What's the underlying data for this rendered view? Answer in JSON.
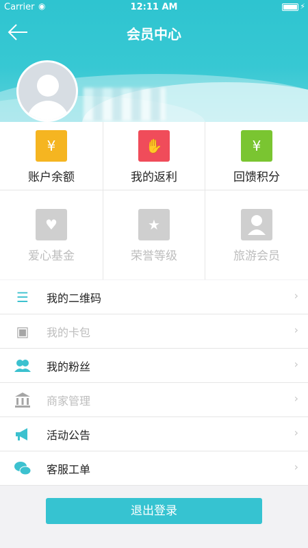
{
  "status_bar": {
    "carrier": "Carrier",
    "time": "12:11 AM"
  },
  "nav": {
    "title": "会员中心"
  },
  "grid": [
    {
      "label": "账户余额",
      "icon": "wallet-yen-icon",
      "color": "#f5b521",
      "glyph": "¥",
      "enabled": true
    },
    {
      "label": "我的返利",
      "icon": "hand-coins-icon",
      "color": "#f04c5a",
      "glyph": "✋",
      "enabled": true
    },
    {
      "label": "回馈积分",
      "icon": "coins-stack-icon",
      "color": "#7ac531",
      "glyph": "¥",
      "enabled": true
    },
    {
      "label": "爱心基金",
      "icon": "hearts-icon",
      "color": "#cfcfcf",
      "glyph": "♥",
      "enabled": false
    },
    {
      "label": "荣誉等级",
      "icon": "badge-star-icon",
      "color": "#cfcfcf",
      "glyph": "★",
      "enabled": false
    },
    {
      "label": "旅游会员",
      "icon": "person-icon",
      "color": "#cfcfcf",
      "glyph": "👤",
      "enabled": false
    }
  ],
  "menu": [
    {
      "label": "我的二维码",
      "icon": "list-lines-icon",
      "glyph": "☰",
      "enabled": true
    },
    {
      "label": "我的卡包",
      "icon": "card-wallet-icon",
      "glyph": "▭",
      "enabled": false
    },
    {
      "label": "我的粉丝",
      "icon": "fans-group-icon",
      "glyph": "👥",
      "enabled": true
    },
    {
      "label": "商家管理",
      "icon": "bank-building-icon",
      "glyph": "🏛",
      "enabled": false
    },
    {
      "label": "活动公告",
      "icon": "megaphone-icon",
      "glyph": "📣",
      "enabled": true
    },
    {
      "label": "客服工单",
      "icon": "chat-bubbles-icon",
      "glyph": "💬",
      "enabled": true
    }
  ],
  "logout_label": "退出登录",
  "colors": {
    "accent": "#36c3d1"
  }
}
